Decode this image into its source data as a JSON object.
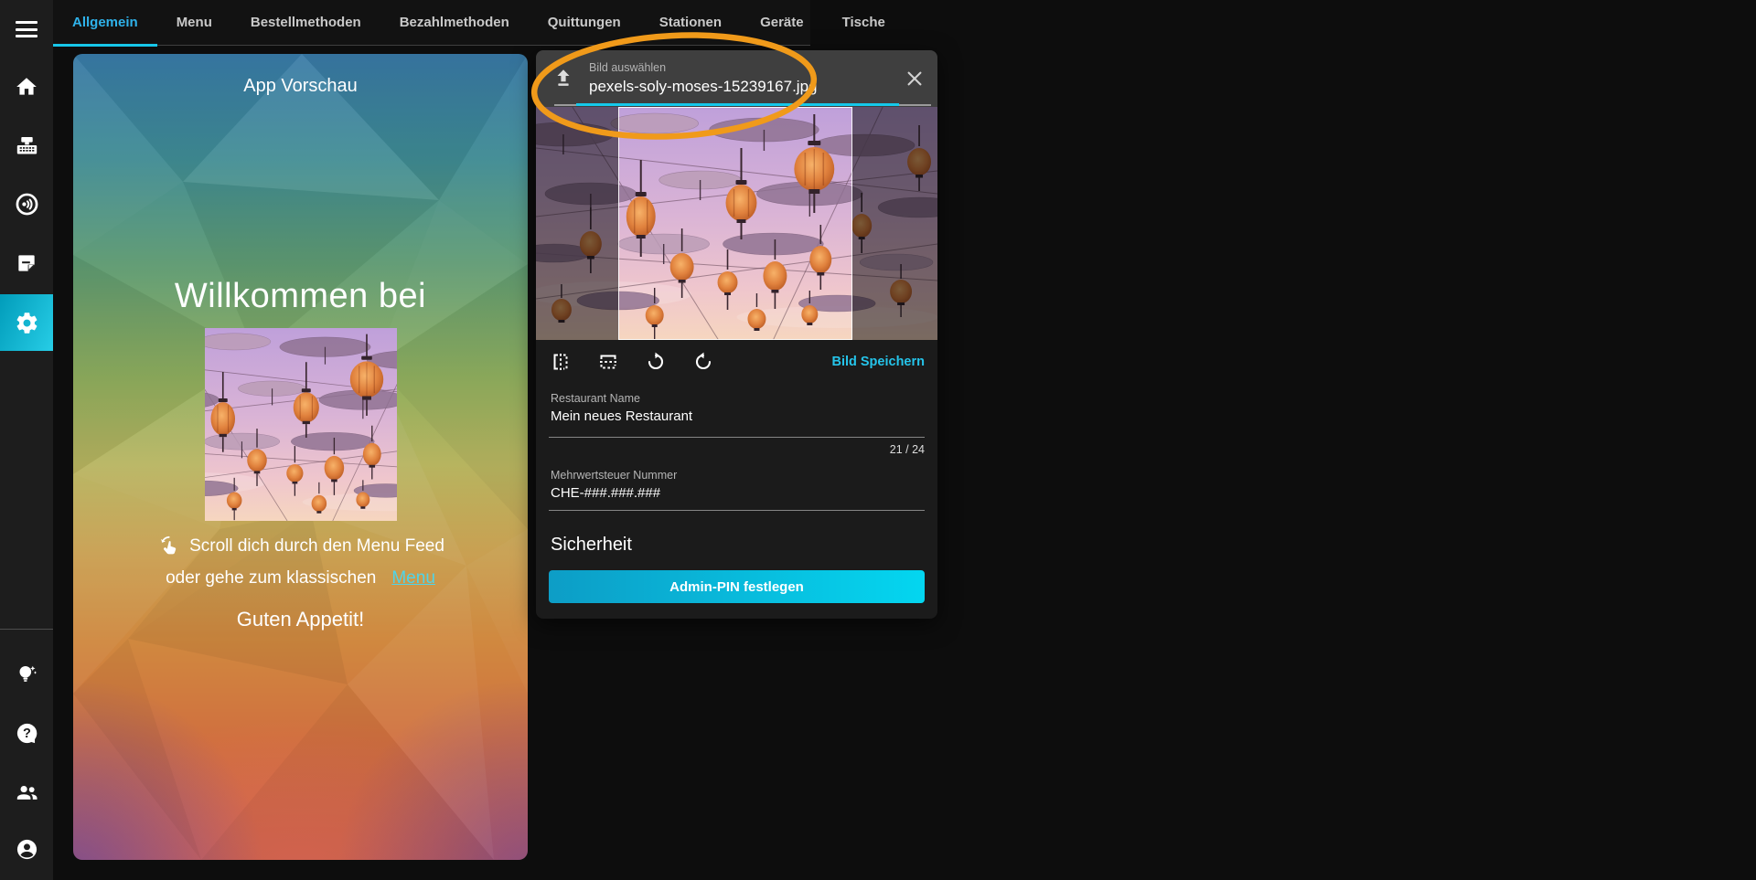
{
  "topbar": {
    "active_tab": "Allgemein",
    "tabs": [
      {
        "label": "Allgemein"
      },
      {
        "label": "Menu"
      },
      {
        "label": "Bestellmethoden"
      },
      {
        "label": "Bezahlmethoden"
      },
      {
        "label": "Quittungen"
      },
      {
        "label": "Stationen"
      },
      {
        "label": "Geräte"
      },
      {
        "label": "Tische"
      }
    ]
  },
  "sidebar": {
    "icons": [
      "menu",
      "home",
      "cash-register",
      "announcement",
      "notes",
      "settings",
      "ideas",
      "help",
      "team",
      "account"
    ],
    "active": "settings"
  },
  "preview": {
    "title": "App Vorschau",
    "headline": "Willkommen bei",
    "scroll_hint": "Scroll dich durch den Menu Feed",
    "classic_prefix": "oder gehe zum klassischen",
    "classic_link": "Menu",
    "footer": "Guten Appetit!"
  },
  "dialog": {
    "upload_label": "Bild auswählen",
    "filename": "pexels-soly-moses-15239167.jpg",
    "save_label": "Bild Speichern",
    "restaurant_name": {
      "label": "Restaurant Name",
      "value": "Mein neues Restaurant",
      "counter": "21 / 24"
    },
    "vat": {
      "label": "Mehrwertsteuer Nummer",
      "value": "CHE-###.###.###"
    },
    "security_heading": "Sicherheit",
    "pin_button": "Admin-PIN festlegen"
  },
  "annotation": {
    "type": "ellipse-highlight",
    "color": "#F09A1A"
  },
  "colors": {
    "accent_cyan": "#17C6E8",
    "accent_blue": "#2FB2EA",
    "button_gradient_start": "#0D9DC6",
    "button_gradient_end": "#04D6F0",
    "sidebar_active_start": "#019CBA",
    "sidebar_active_end": "#27CDE6"
  }
}
